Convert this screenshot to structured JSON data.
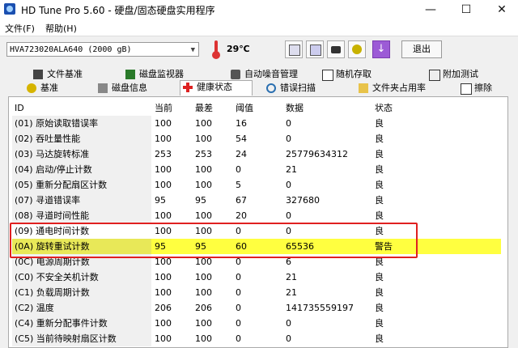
{
  "window": {
    "title": "HD Tune Pro 5.60 - 硬盘/固态硬盘实用程序",
    "min": "—",
    "max": "☐",
    "close": "✕"
  },
  "menu": {
    "file": "文件(F)",
    "help": "帮助(H)"
  },
  "toolbar": {
    "drive": "HVA723020ALA640 (2000 gB)",
    "temperature": "29℃",
    "exit": "退出"
  },
  "tabs_top": [
    "文件基准",
    "磁盘监视器",
    "自动噪音管理",
    "随机存取",
    "附加测试"
  ],
  "tabs_bottom": [
    "基准",
    "磁盘信息",
    "健康状态",
    "错误扫描",
    "文件夹占用率",
    "擦除"
  ],
  "active_tab": "健康状态",
  "table": {
    "headers": {
      "id": "ID",
      "current": "当前",
      "worst": "最差",
      "threshold": "阈值",
      "data": "数据",
      "status": "状态"
    },
    "rows": [
      {
        "id": "(01) 原始读取错误率",
        "current": "100",
        "worst": "100",
        "threshold": "16",
        "data": "0",
        "status": "良"
      },
      {
        "id": "(02) 吞吐量性能",
        "current": "100",
        "worst": "100",
        "threshold": "54",
        "data": "0",
        "status": "良"
      },
      {
        "id": "(03) 马达旋转标准",
        "current": "253",
        "worst": "253",
        "threshold": "24",
        "data": "25779634312",
        "status": "良"
      },
      {
        "id": "(04) 启动/停止计数",
        "current": "100",
        "worst": "100",
        "threshold": "0",
        "data": "21",
        "status": "良"
      },
      {
        "id": "(05) 重新分配扇区计数",
        "current": "100",
        "worst": "100",
        "threshold": "5",
        "data": "0",
        "status": "良"
      },
      {
        "id": "(07) 寻道错误率",
        "current": "95",
        "worst": "95",
        "threshold": "67",
        "data": "327680",
        "status": "良"
      },
      {
        "id": "(08) 寻道时间性能",
        "current": "100",
        "worst": "100",
        "threshold": "20",
        "data": "0",
        "status": "良"
      },
      {
        "id": "(09) 通电时间计数",
        "current": "100",
        "worst": "100",
        "threshold": "0",
        "data": "0",
        "status": "良"
      },
      {
        "id": "(0A) 旋转重试计数",
        "current": "95",
        "worst": "95",
        "threshold": "60",
        "data": "65536",
        "status": "警告"
      },
      {
        "id": "(0C) 电源周期计数",
        "current": "100",
        "worst": "100",
        "threshold": "0",
        "data": "6",
        "status": "良"
      },
      {
        "id": "(C0) 不安全关机计数",
        "current": "100",
        "worst": "100",
        "threshold": "0",
        "data": "21",
        "status": "良"
      },
      {
        "id": "(C1) 负载周期计数",
        "current": "100",
        "worst": "100",
        "threshold": "0",
        "data": "21",
        "status": "良"
      },
      {
        "id": "(C2) 温度",
        "current": "206",
        "worst": "206",
        "threshold": "0",
        "data": "141735559197",
        "status": "良"
      },
      {
        "id": "(C4) 重新分配事件计数",
        "current": "100",
        "worst": "100",
        "threshold": "0",
        "data": "0",
        "status": "良"
      },
      {
        "id": "(C5) 当前待映射扇区计数",
        "current": "100",
        "worst": "100",
        "threshold": "0",
        "data": "0",
        "status": "良"
      }
    ]
  },
  "colors": {
    "warning_row": "#ffff40",
    "highlight_box": "#e02020"
  }
}
